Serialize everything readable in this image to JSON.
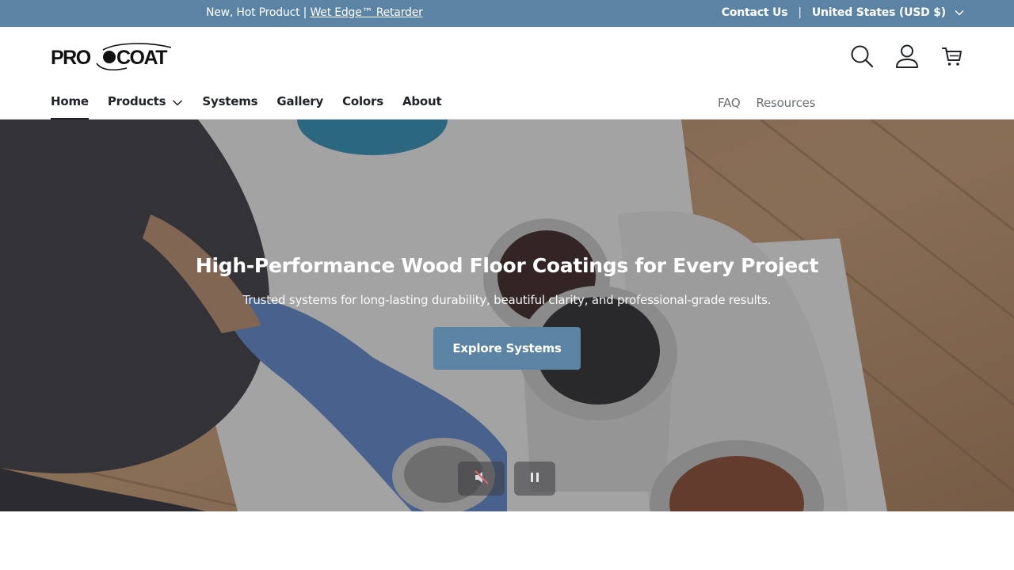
{
  "announcement": {
    "promo_prefix": "New, Hot Product | ",
    "promo_link": "Wet Edge™ Retarder",
    "contact": "Contact Us",
    "separator": "|",
    "region": "United States (USD $)"
  },
  "header": {
    "logo_text": "PRO COAT",
    "icons": [
      "search-icon",
      "account-icon",
      "cart-icon"
    ]
  },
  "main_nav": [
    {
      "label": "Home",
      "active": true
    },
    {
      "label": "Products",
      "has_dropdown": true
    },
    {
      "label": "Systems"
    },
    {
      "label": "Gallery"
    },
    {
      "label": "Colors"
    },
    {
      "label": "About"
    }
  ],
  "secondary_nav": [
    {
      "label": "FAQ"
    },
    {
      "label": "Resources"
    }
  ],
  "hero": {
    "title": "High-Performance Wood Floor Coatings for Every Project",
    "subtitle": "Trusted systems for long-lasting durability, beautiful clarity, and professional-grade results.",
    "cta": "Explore Systems"
  },
  "colors": {
    "brand_blue": "#5b84a4",
    "text_dark": "#1f2328",
    "text_muted": "#6b6f73"
  }
}
